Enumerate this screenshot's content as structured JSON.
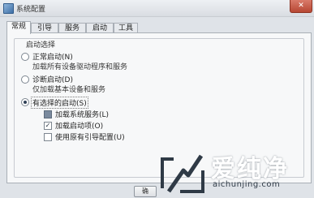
{
  "window": {
    "title": "系统配置",
    "close_glyph": "✕",
    "icon": "msconfig-icon"
  },
  "tabs": [
    {
      "label": "常规",
      "active": true
    },
    {
      "label": "引导",
      "active": false
    },
    {
      "label": "服务",
      "active": false
    },
    {
      "label": "启动",
      "active": false
    },
    {
      "label": "工具",
      "active": false
    }
  ],
  "startup_group": {
    "legend": "启动选择",
    "options": [
      {
        "label": "正常启动(N)",
        "description": "加载所有设备驱动程序和服务",
        "selected": false
      },
      {
        "label": "诊断启动(D)",
        "description": "仅加载基本设备和服务",
        "selected": false
      },
      {
        "label": "有选择的启动(S)",
        "selected": true
      }
    ],
    "selective_items": [
      {
        "label": "加载系统服务(L)",
        "checked": true,
        "state": "indeterminate"
      },
      {
        "label": "加载启动项(O)",
        "checked": true,
        "state": "checked"
      },
      {
        "label": "使用原有引导配置(U)",
        "checked": false,
        "state": "unchecked"
      }
    ]
  },
  "bottom_button_partial": "确",
  "watermark": {
    "chars": "爱纯净",
    "url": "aichunjing.com"
  }
}
